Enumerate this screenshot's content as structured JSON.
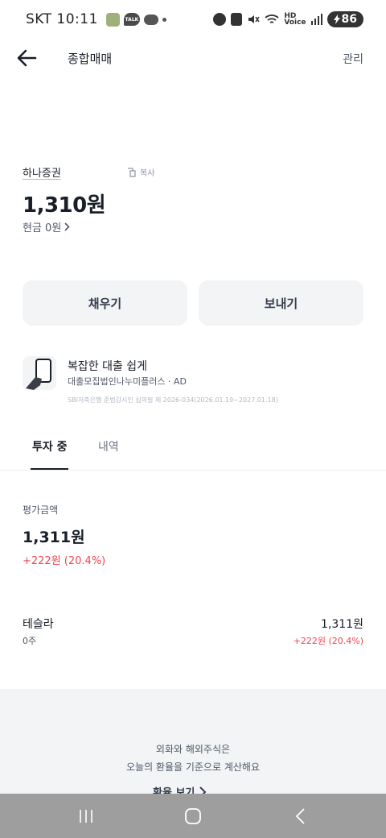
{
  "status_bar": {
    "carrier": "SKT",
    "time": "10:11",
    "talk_badge": "TALK",
    "hd_label": "HD",
    "voice_label": "Voice",
    "battery": "86"
  },
  "header": {
    "title": "종합매매",
    "manage_label": "관리"
  },
  "account": {
    "name": "하나증권",
    "copy_label": "복사",
    "balance": "1,310원",
    "cash_label": "현금 0원"
  },
  "actions": {
    "fill_label": "채우기",
    "send_label": "보내기"
  },
  "ad": {
    "title": "복잡한 대출 쉽게",
    "subtitle": "대출모집법인나누미플러스 · AD",
    "legal": "SBI저축은행 준법감시인 심의필 제 2026-034(2026.01.19~2027.01.18)"
  },
  "tabs": [
    {
      "label": "투자 중",
      "active": true
    },
    {
      "label": "내역",
      "active": false
    }
  ],
  "evaluation": {
    "label": "평가금액",
    "amount": "1,311원",
    "change": "+222원 (20.4%)"
  },
  "holdings": [
    {
      "name": "테슬라",
      "qty": "0주",
      "value": "1,311원",
      "change": "+222원 (20.4%)"
    }
  ],
  "footer": {
    "line1": "외화와 해외주식은",
    "line2": "오늘의 환율을 기준으로 계산해요",
    "rate_link": "환율 보기"
  },
  "colors": {
    "text_primary": "#191f28",
    "text_secondary": "#4e5968",
    "positive_red": "#f04452",
    "button_bg": "#f2f4f6",
    "nav_bar": "#9e9e9e"
  },
  "icons": {
    "back": "back-arrow-icon",
    "copy": "copy-icon",
    "cash_chevron": "chevron-right-icon",
    "ad": "phone-hand-icon",
    "rate_chevron": "chevron-right-icon",
    "nav_recents": "recents-icon",
    "nav_home": "home-icon",
    "nav_back": "nav-back-icon"
  }
}
